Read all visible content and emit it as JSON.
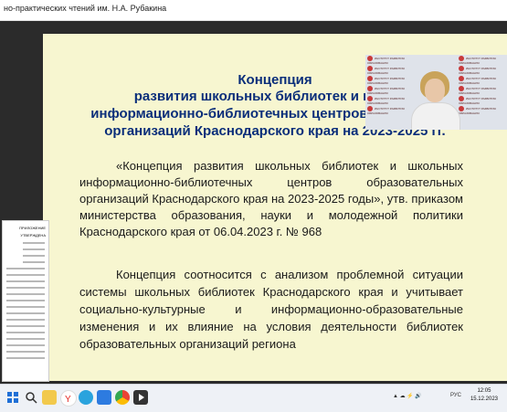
{
  "window": {
    "title": "но-практических чтений им. Н.А. Рубакина"
  },
  "slide": {
    "title_lines": [
      "Концепция",
      "развития школьных библиотек и школ",
      "информационно-библиотечных центров обра",
      "организаций Краснодарского края на 2023-2025 гг."
    ],
    "paragraph1": "«Концепция развития школьных библиотек и школьных информационно-библиотечных центров образовательных организаций Краснодарского края на 2023-2025 годы», утв. приказом министерства образования, науки и молодежной политики Краснодарского края от 06.04.2023 г. № 968",
    "paragraph2": "Концепция соотносится с анализом проблемной ситуации системы школьных библиотек Краснодарского края и учитывает социально-культурные и информационно-образовательные изменения и их влияние на условия деятельности библиотек образовательных организаций региона"
  },
  "document_thumb": {
    "heading": "ПРИЛОЖЕНИЕ",
    "subheading": "УТВЕРЖДЕНА"
  },
  "video": {
    "banner_text": "ИНСТИТУТ РАЗВИТИЯ ОБРАЗОВАНИЯ КРАСНОДАРСКОГО КРАЯ"
  },
  "taskbar": {
    "language": "РУС",
    "time": "12:05",
    "date": "15.12.2023",
    "icons": [
      "windows-icon",
      "search-icon",
      "files-icon",
      "yandex-browser-icon",
      "telegram-icon",
      "app-icon",
      "chrome-icon",
      "media-player-icon"
    ],
    "accent": "#1f6fd6"
  }
}
